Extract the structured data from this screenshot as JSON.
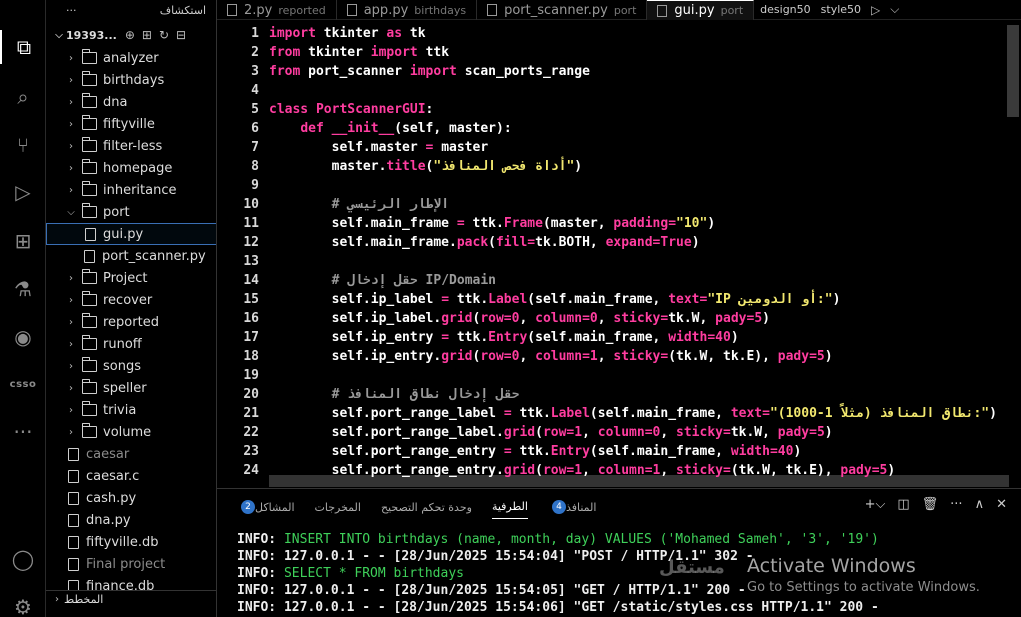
{
  "activity_bar": {
    "items": [
      {
        "name": "explorer-icon",
        "glyph": "⧉",
        "active": true
      },
      {
        "name": "search-icon",
        "glyph": "⌕",
        "active": false
      },
      {
        "name": "source-control-icon",
        "glyph": "⑂",
        "active": false
      },
      {
        "name": "run-debug-icon",
        "glyph": "▷",
        "active": false
      },
      {
        "name": "extensions-icon",
        "glyph": "⊞",
        "active": false
      },
      {
        "name": "testing-icon",
        "glyph": "⚗",
        "active": false
      },
      {
        "name": "github-icon",
        "glyph": "◉",
        "active": false
      }
    ],
    "csso_label": "csso",
    "more": "···",
    "account_glyph": "◯",
    "settings_glyph": "⚙"
  },
  "sidebar": {
    "header": "استكشاف",
    "header_more": "···",
    "root_name": "19393...",
    "tools": [
      "⊕",
      "⊞",
      "↻",
      "⊟"
    ],
    "items": [
      {
        "label": "analyzer",
        "kind": "folder",
        "open": false
      },
      {
        "label": "birthdays",
        "kind": "folder",
        "open": false
      },
      {
        "label": "dna",
        "kind": "folder",
        "open": false
      },
      {
        "label": "fiftyville",
        "kind": "folder",
        "open": false
      },
      {
        "label": "filter-less",
        "kind": "folder",
        "open": false
      },
      {
        "label": "homepage",
        "kind": "folder",
        "open": false
      },
      {
        "label": "inheritance",
        "kind": "folder",
        "open": false
      },
      {
        "label": "port",
        "kind": "folder",
        "open": true
      },
      {
        "label": "gui.py",
        "kind": "file",
        "indent": true,
        "selected": true
      },
      {
        "label": "port_scanner.py",
        "kind": "file",
        "indent": true
      },
      {
        "label": "Project",
        "kind": "folder",
        "open": false
      },
      {
        "label": "recover",
        "kind": "folder",
        "open": false
      },
      {
        "label": "reported",
        "kind": "folder",
        "open": false
      },
      {
        "label": "runoff",
        "kind": "folder",
        "open": false
      },
      {
        "label": "songs",
        "kind": "folder",
        "open": false
      },
      {
        "label": "speller",
        "kind": "folder",
        "open": false
      },
      {
        "label": "trivia",
        "kind": "folder",
        "open": false
      },
      {
        "label": "volume",
        "kind": "folder",
        "open": false
      },
      {
        "label": "caesar",
        "kind": "file",
        "dim": true
      },
      {
        "label": "caesar.c",
        "kind": "file"
      },
      {
        "label": "cash.py",
        "kind": "file"
      },
      {
        "label": "dna.py",
        "kind": "file"
      },
      {
        "label": "fiftyville.db",
        "kind": "file"
      },
      {
        "label": "Final project",
        "kind": "file",
        "dim": true
      },
      {
        "label": "finance.db",
        "kind": "file"
      }
    ],
    "footer": "المخطط"
  },
  "tabs": [
    {
      "label": "2.py",
      "sub": "reported",
      "active": false
    },
    {
      "label": "app.py",
      "sub": "birthdays",
      "active": false
    },
    {
      "label": "port_scanner.py",
      "sub": "port",
      "active": false
    },
    {
      "label": "gui.py",
      "sub": "port",
      "active": true
    }
  ],
  "tab_extra": {
    "a": "design50",
    "b": "style50",
    "run": "▷",
    "split": "⌵"
  },
  "editor": {
    "lines": [
      {
        "n": "1",
        "segs": [
          [
            "kw",
            "import "
          ],
          [
            "id",
            "tkinter "
          ],
          [
            "kw",
            "as "
          ],
          [
            "id",
            "tk"
          ]
        ]
      },
      {
        "n": "2",
        "segs": [
          [
            "kw",
            "from "
          ],
          [
            "id",
            "tkinter "
          ],
          [
            "kw",
            "import "
          ],
          [
            "id",
            "ttk"
          ]
        ]
      },
      {
        "n": "3",
        "segs": [
          [
            "kw",
            "from "
          ],
          [
            "id",
            "port_scanner "
          ],
          [
            "kw",
            "import "
          ],
          [
            "id",
            "scan_ports_range"
          ]
        ]
      },
      {
        "n": "4",
        "segs": []
      },
      {
        "n": "5",
        "segs": [
          [
            "kw",
            "class "
          ],
          [
            "fn",
            "PortScannerGUI"
          ],
          [
            "id",
            ":"
          ]
        ]
      },
      {
        "n": "6",
        "segs": [
          [
            "id",
            "    "
          ],
          [
            "kw",
            "def "
          ],
          [
            "fn",
            "__init__"
          ],
          [
            "id",
            "(self, master):"
          ]
        ]
      },
      {
        "n": "7",
        "segs": [
          [
            "id",
            "        self.master "
          ],
          [
            "kw",
            "= "
          ],
          [
            "id",
            "master"
          ]
        ]
      },
      {
        "n": "8",
        "segs": [
          [
            "id",
            "        master."
          ],
          [
            "fn",
            "title"
          ],
          [
            "id",
            "("
          ],
          [
            "str",
            "\"أداة فحص المنافذ\""
          ],
          [
            "id",
            ")"
          ]
        ]
      },
      {
        "n": "9",
        "segs": []
      },
      {
        "n": "10",
        "segs": [
          [
            "cm",
            "        # الإطار الرئيسي"
          ]
        ]
      },
      {
        "n": "11",
        "segs": [
          [
            "id",
            "        self.main_frame "
          ],
          [
            "kw",
            "= "
          ],
          [
            "id",
            "ttk."
          ],
          [
            "fn",
            "Frame"
          ],
          [
            "id",
            "(master, "
          ],
          [
            "kw",
            "padding="
          ],
          [
            "str",
            "\"10\""
          ],
          [
            "id",
            ")"
          ]
        ]
      },
      {
        "n": "12",
        "segs": [
          [
            "id",
            "        self.main_frame."
          ],
          [
            "fn",
            "pack"
          ],
          [
            "id",
            "("
          ],
          [
            "kw",
            "fill="
          ],
          [
            "id",
            "tk.BOTH, "
          ],
          [
            "kw",
            "expand="
          ],
          [
            "num",
            "True"
          ],
          [
            "id",
            ")"
          ]
        ]
      },
      {
        "n": "13",
        "segs": []
      },
      {
        "n": "14",
        "segs": [
          [
            "cm",
            "        # حقل إدخال IP/Domain"
          ]
        ]
      },
      {
        "n": "15",
        "segs": [
          [
            "id",
            "        self.ip_label "
          ],
          [
            "kw",
            "= "
          ],
          [
            "id",
            "ttk."
          ],
          [
            "fn",
            "Label"
          ],
          [
            "id",
            "(self.main_frame, "
          ],
          [
            "kw",
            "text="
          ],
          [
            "str",
            "\"IP أو الدومين:\""
          ],
          [
            "id",
            ")"
          ]
        ]
      },
      {
        "n": "16",
        "segs": [
          [
            "id",
            "        self.ip_label."
          ],
          [
            "fn",
            "grid"
          ],
          [
            "id",
            "("
          ],
          [
            "kw",
            "row="
          ],
          [
            "num",
            "0"
          ],
          [
            "id",
            ", "
          ],
          [
            "kw",
            "column="
          ],
          [
            "num",
            "0"
          ],
          [
            "id",
            ", "
          ],
          [
            "kw",
            "sticky="
          ],
          [
            "id",
            "tk.W, "
          ],
          [
            "kw",
            "pady="
          ],
          [
            "num",
            "5"
          ],
          [
            "id",
            ")"
          ]
        ]
      },
      {
        "n": "17",
        "segs": [
          [
            "id",
            "        self.ip_entry "
          ],
          [
            "kw",
            "= "
          ],
          [
            "id",
            "ttk."
          ],
          [
            "fn",
            "Entry"
          ],
          [
            "id",
            "(self.main_frame, "
          ],
          [
            "kw",
            "width="
          ],
          [
            "num",
            "40"
          ],
          [
            "id",
            ")"
          ]
        ]
      },
      {
        "n": "18",
        "segs": [
          [
            "id",
            "        self.ip_entry."
          ],
          [
            "fn",
            "grid"
          ],
          [
            "id",
            "("
          ],
          [
            "kw",
            "row="
          ],
          [
            "num",
            "0"
          ],
          [
            "id",
            ", "
          ],
          [
            "kw",
            "column="
          ],
          [
            "num",
            "1"
          ],
          [
            "id",
            ", "
          ],
          [
            "kw",
            "sticky="
          ],
          [
            "id",
            "(tk.W, tk.E), "
          ],
          [
            "kw",
            "pady="
          ],
          [
            "num",
            "5"
          ],
          [
            "id",
            ")"
          ]
        ]
      },
      {
        "n": "19",
        "segs": []
      },
      {
        "n": "20",
        "segs": [
          [
            "cm",
            "        # حقل إدخال نطاق المنافذ"
          ]
        ]
      },
      {
        "n": "21",
        "segs": [
          [
            "id",
            "        self.port_range_label "
          ],
          [
            "kw",
            "= "
          ],
          [
            "id",
            "ttk."
          ],
          [
            "fn",
            "Label"
          ],
          [
            "id",
            "(self.main_frame, "
          ],
          [
            "kw",
            "text="
          ],
          [
            "str",
            "\"نطاق المنافذ (مثلاً 1-1000):\""
          ],
          [
            "id",
            ")"
          ]
        ]
      },
      {
        "n": "22",
        "segs": [
          [
            "id",
            "        self.port_range_label."
          ],
          [
            "fn",
            "grid"
          ],
          [
            "id",
            "("
          ],
          [
            "kw",
            "row="
          ],
          [
            "num",
            "1"
          ],
          [
            "id",
            ", "
          ],
          [
            "kw",
            "column="
          ],
          [
            "num",
            "0"
          ],
          [
            "id",
            ", "
          ],
          [
            "kw",
            "sticky="
          ],
          [
            "id",
            "tk.W, "
          ],
          [
            "kw",
            "pady="
          ],
          [
            "num",
            "5"
          ],
          [
            "id",
            ")"
          ]
        ]
      },
      {
        "n": "23",
        "segs": [
          [
            "id",
            "        self.port_range_entry "
          ],
          [
            "kw",
            "= "
          ],
          [
            "id",
            "ttk."
          ],
          [
            "fn",
            "Entry"
          ],
          [
            "id",
            "(self.main_frame, "
          ],
          [
            "kw",
            "width="
          ],
          [
            "num",
            "40"
          ],
          [
            "id",
            ")"
          ]
        ]
      },
      {
        "n": "24",
        "segs": [
          [
            "id",
            "        self.port_range_entry."
          ],
          [
            "fn",
            "grid"
          ],
          [
            "id",
            "("
          ],
          [
            "kw",
            "row="
          ],
          [
            "num",
            "1"
          ],
          [
            "id",
            ", "
          ],
          [
            "kw",
            "column="
          ],
          [
            "num",
            "1"
          ],
          [
            "id",
            ", "
          ],
          [
            "kw",
            "sticky="
          ],
          [
            "id",
            "(tk.W, tk.E), "
          ],
          [
            "kw",
            "pady="
          ],
          [
            "num",
            "5"
          ],
          [
            "id",
            ")"
          ]
        ]
      }
    ]
  },
  "panel": {
    "tabs": [
      {
        "label": "المشاكل",
        "badge": "2",
        "active": false
      },
      {
        "label": "المخرجات",
        "badge": null,
        "active": false
      },
      {
        "label": "وحدة تحكم التصحيح",
        "badge": null,
        "active": false
      },
      {
        "label": "الطرفية",
        "badge": null,
        "active": true
      },
      {
        "label": "المنافذ",
        "badge": "4",
        "active": false
      }
    ],
    "controls": [
      "+⌵",
      "◫",
      "🗑",
      "···",
      "∧",
      "✕"
    ],
    "terminal": [
      [
        [
          "w",
          "INFO: "
        ],
        [
          "g",
          "INSERT INTO birthdays (name, month, day) VALUES ('Mohamed Sameh', '3', '19')"
        ]
      ],
      [
        [
          "w",
          "INFO: 127.0.0.1 - - [28/Jun/2025 15:54:04] \"POST / HTTP/1.1\" 302 -"
        ]
      ],
      [
        [
          "w",
          "INFO: "
        ],
        [
          "g",
          "SELECT * FROM birthdays"
        ]
      ],
      [
        [
          "w",
          "INFO: 127.0.0.1 - - [28/Jun/2025 15:54:05] \"GET / HTTP/1.1\" 200 -"
        ]
      ],
      [
        [
          "w",
          "INFO: 127.0.0.1 - - [28/Jun/2025 15:54:06] \"GET /static/styles.css HTTP/1.1\" 200 -"
        ]
      ]
    ],
    "watermark_title": "Activate Windows",
    "watermark_sub": "Go to Settings to activate Windows.",
    "logo_text": "مستقل"
  }
}
